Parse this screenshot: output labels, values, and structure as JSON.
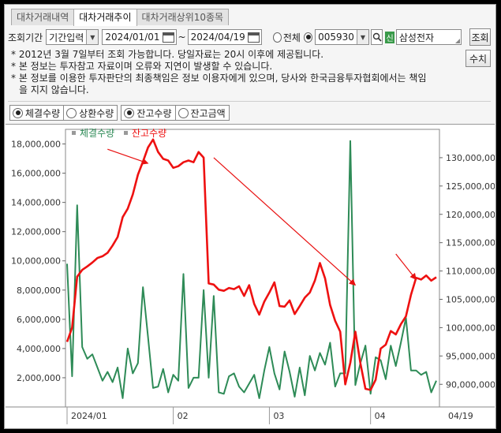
{
  "tabs": [
    {
      "label": "대차거래내역"
    },
    {
      "label": "대차거래추이"
    },
    {
      "label": "대차거래상위10종목"
    }
  ],
  "controls": {
    "period_label": "조회기간",
    "period_mode": "기간입력",
    "start_date": "2024/01/01",
    "date_sep": "~",
    "end_date": "2024/04/19",
    "all_label": "전체",
    "stock_code": "005930",
    "stock_badge": "신",
    "stock_name": "삼성전자",
    "query_button": "조회",
    "values_button": "수치"
  },
  "notes": [
    "* 2012년 3월 7일부터 조회 가능합니다. 당일자료는 20시 이후에 제공됩니다.",
    "* 본 정보는 투자참고 자료이며 오류와 지연이 발생할 수 있습니다.",
    "* 본 정보를 이용한 투자판단의 최종책임은 정보 이용자에게 있으며, 당사와 한국금융투자협회에서는 책임",
    "을 지지 않습니다."
  ],
  "options": [
    {
      "label": "체결수량",
      "selected": true
    },
    {
      "label": "상환수량",
      "selected": false
    },
    {
      "label": "잔고수량",
      "selected": true
    },
    {
      "label": "잔고금액",
      "selected": false
    }
  ],
  "chart_data": {
    "type": "line",
    "legend": [
      {
        "name": "체결수량",
        "color": "#2e8b57"
      },
      {
        "name": "잔고수량",
        "color": "#ee1111"
      }
    ],
    "left_axis": {
      "min": 0,
      "max": 19000000,
      "ticks": [
        "2,000,000",
        "4,000,000",
        "6,000,000",
        "8,000,000",
        "10,000,000",
        "12,000,000",
        "14,000,000",
        "16,000,000",
        "18,000,000"
      ]
    },
    "right_axis": {
      "min": 86000000,
      "max": 135000000,
      "ticks": [
        "90,000,000",
        "95,000,000",
        "100,000,000",
        "105,000,000",
        "110,000,000",
        "115,000,000",
        "120,000,000",
        "125,000,000",
        "130,000,000"
      ]
    },
    "x_tick_labels": [
      {
        "label": "2024/01",
        "index": 0
      },
      {
        "label": "02",
        "index": 21
      },
      {
        "label": "03",
        "index": 40
      },
      {
        "label": "04",
        "index": 60
      },
      {
        "label": "04/19",
        "index": 73
      }
    ],
    "x_count": 74,
    "series": [
      {
        "name": "체결수량",
        "color": "#2e8b57",
        "axis": "left",
        "values": [
          9800000,
          2100000,
          13800000,
          4100000,
          3300000,
          3600000,
          2700000,
          1800000,
          2400000,
          1700000,
          2700000,
          600000,
          4000000,
          2300000,
          3000000,
          8200000,
          4800000,
          1300000,
          1400000,
          2600000,
          1000000,
          2200000,
          1800000,
          9100000,
          1300000,
          2000000,
          2000000,
          8000000,
          2000000,
          7600000,
          1000000,
          900000,
          2100000,
          2300000,
          1400000,
          1000000,
          1600000,
          2200000,
          600000,
          2500000,
          4100000,
          2300000,
          1200000,
          3800000,
          2400000,
          700000,
          2700000,
          800000,
          3500000,
          2500000,
          3700000,
          2900000,
          4400000,
          1400000,
          2300000,
          2300000,
          18200000,
          1500000,
          3000000,
          4200000,
          900000,
          3400000,
          3200000,
          1900000,
          4200000,
          2800000,
          4400000,
          6100000,
          2500000,
          2500000,
          2200000,
          2400000,
          1000000,
          1800000
        ]
      },
      {
        "name": "잔고수량",
        "color": "#ee1111",
        "axis": "right",
        "values": [
          97500000,
          100000000,
          109000000,
          110200000,
          110800000,
          111500000,
          112300000,
          112600000,
          113200000,
          114500000,
          116000000,
          119500000,
          121000000,
          123500000,
          127000000,
          129300000,
          131800000,
          133200000,
          131000000,
          129800000,
          129500000,
          128200000,
          128500000,
          129200000,
          129500000,
          129200000,
          131000000,
          130000000,
          107800000,
          107600000,
          106700000,
          106500000,
          107000000,
          106800000,
          107300000,
          105600000,
          107500000,
          104200000,
          102300000,
          104600000,
          106200000,
          108000000,
          103800000,
          103700000,
          104800000,
          102400000,
          103800000,
          105300000,
          106200000,
          108300000,
          111400000,
          108700000,
          104000000,
          101200000,
          99300000,
          90000000,
          93800000,
          99300000,
          93700000,
          89200000,
          89000000,
          90800000,
          96300000,
          97000000,
          99400000,
          98800000,
          100600000,
          102000000,
          105800000,
          108800000,
          108500000,
          109200000,
          108300000,
          108900000
        ]
      }
    ],
    "annotations": [
      {
        "type": "arrow",
        "color": "#e81010",
        "from": [
          8,
          131500000
        ],
        "to": [
          16,
          129000000
        ]
      },
      {
        "type": "arrow",
        "color": "#e81010",
        "from": [
          29,
          130000000
        ],
        "to": [
          57,
          107500000
        ]
      },
      {
        "type": "arrow",
        "color": "#e81010",
        "from": [
          65,
          113000000
        ],
        "to": [
          69,
          108500000
        ]
      }
    ]
  }
}
